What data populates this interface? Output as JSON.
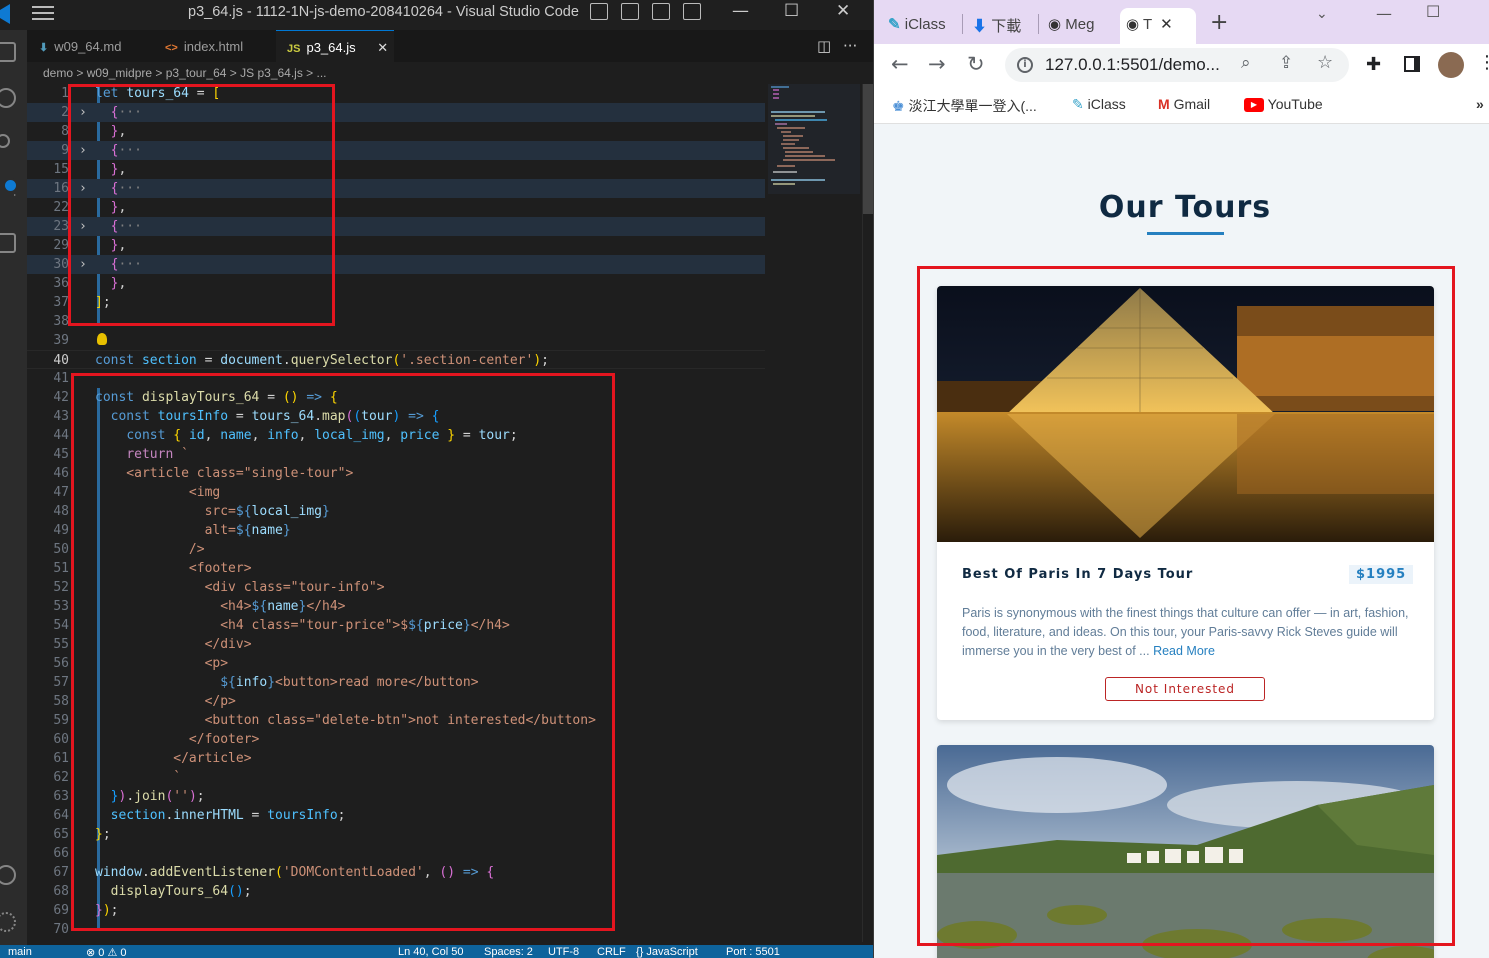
{
  "vscode": {
    "window_title": "p3_64.js - 1112-1N-js-demo-208410264 - Visual Studio Code",
    "tabs": [
      {
        "label": "w09_64.md",
        "icon": "markdown-icon"
      },
      {
        "label": "index.html",
        "icon": "html-icon"
      },
      {
        "label": "p3_64.js",
        "icon": "js-icon",
        "active": true
      }
    ],
    "breadcrumb": "demo > w09_midpre > p3_tour_64 > JS p3_64.js > ...",
    "code_lines": [
      {
        "n": "1"
      },
      {
        "n": "2"
      },
      {
        "n": "8"
      },
      {
        "n": "9"
      },
      {
        "n": "15"
      },
      {
        "n": "16"
      },
      {
        "n": "22"
      },
      {
        "n": "23"
      },
      {
        "n": "29"
      },
      {
        "n": "30"
      },
      {
        "n": "36"
      },
      {
        "n": "37"
      },
      {
        "n": "38"
      },
      {
        "n": "39"
      },
      {
        "n": "40"
      },
      {
        "n": "41"
      },
      {
        "n": "42"
      },
      {
        "n": "43"
      },
      {
        "n": "44"
      },
      {
        "n": "45"
      },
      {
        "n": "46"
      },
      {
        "n": "47"
      },
      {
        "n": "48"
      },
      {
        "n": "49"
      },
      {
        "n": "50"
      },
      {
        "n": "51"
      },
      {
        "n": "52"
      },
      {
        "n": "53"
      },
      {
        "n": "54"
      },
      {
        "n": "55"
      },
      {
        "n": "56"
      },
      {
        "n": "57"
      },
      {
        "n": "58"
      },
      {
        "n": "59"
      },
      {
        "n": "60"
      },
      {
        "n": "61"
      },
      {
        "n": "62"
      },
      {
        "n": "63"
      },
      {
        "n": "64"
      },
      {
        "n": "65"
      },
      {
        "n": "66"
      },
      {
        "n": "67"
      },
      {
        "n": "68"
      },
      {
        "n": "69"
      },
      {
        "n": "70"
      }
    ],
    "status": {
      "branch": "main",
      "problems": "⊗ 0 ⚠ 0",
      "position": "Ln 40, Col 50",
      "spaces": "Spaces: 2",
      "encoding": "UTF-8",
      "eol": "CRLF",
      "language": "{} JavaScript",
      "port": "Port : 5501"
    }
  },
  "browser": {
    "tabs": [
      "iClass",
      "下載",
      "Meg",
      "T"
    ],
    "url": "127.0.0.1:5501/demo...",
    "bookmarks": [
      "淡江大學單一登入(...",
      "iClass",
      "Gmail",
      "YouTube"
    ],
    "page_title": "Our Tours",
    "tours": [
      {
        "name": "Best Of Paris In 7 Days Tour",
        "price": "$1995",
        "info": "Paris is synonymous with the finest things that culture can offer — in art, fashion, food, literature, and ideas. On this tour, your Paris-savvy Rick Steves guide will immerse you in the very best of ...",
        "read_more": "Read More",
        "delete_label": "Not Interested"
      }
    ]
  },
  "colors": {
    "annotation_red": "#e4151f",
    "statusbar_blue": "#0e639c",
    "brand_blue": "#2680c0",
    "title_navy": "#102a42",
    "delete_red": "#bb2525"
  }
}
